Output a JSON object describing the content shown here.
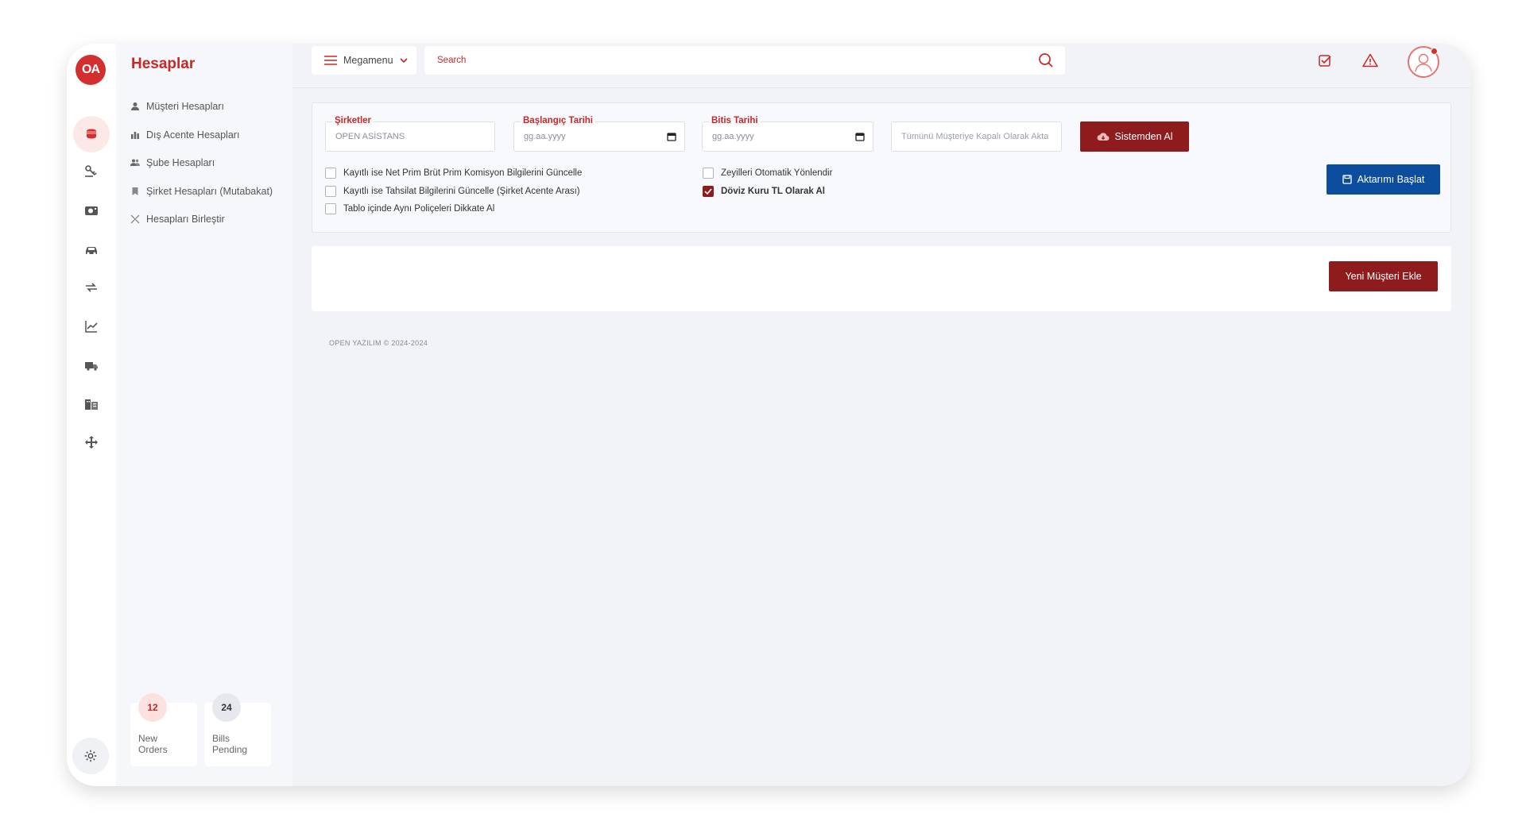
{
  "sidebar": {
    "logo_text": "OA",
    "rail_icons": [
      "coins-icon",
      "key-hand-icon",
      "camera-icon",
      "car-icon",
      "transfer-icon",
      "chart-icon",
      "truck-icon",
      "building-icon",
      "move-icon"
    ],
    "settings_icon": "gear-icon"
  },
  "submenu": {
    "title": "Hesaplar",
    "items": [
      {
        "label": "Müşteri Hesapları",
        "icon": "user-icon"
      },
      {
        "label": "Dış Acente Hesapları",
        "icon": "bar-chart-icon"
      },
      {
        "label": "Şube Hesapları",
        "icon": "users-icon"
      },
      {
        "label": "Şirket Hesapları (Mutabakat)",
        "icon": "bookmark-icon"
      },
      {
        "label": "Hesapları Birleştir",
        "icon": "merge-icon"
      }
    ],
    "stats": [
      {
        "count": "12",
        "label": "New Orders",
        "color": "#fde1e1"
      },
      {
        "count": "24",
        "label": "Bills Pending",
        "color": "#e6e8ee"
      }
    ]
  },
  "topbar": {
    "megamenu_label": "Megamenu",
    "search_placeholder": "Search"
  },
  "filters": {
    "company": {
      "label": "Şirketler",
      "value": "OPEN ASİSTANS"
    },
    "start_date": {
      "label": "Başlangıç Tarihi",
      "placeholder": "gg.aa.yyyy"
    },
    "end_date": {
      "label": "Bitis Tarihi",
      "placeholder": "gg.aa.yyyy"
    },
    "transfer_field": {
      "value": "Tümünü Müşteriye Kapalı Olarak Akta"
    },
    "fetch_button": "Sistemden Al",
    "start_button": "Aktarımı Başlat",
    "checkboxes": [
      {
        "label": "Kayıtlı ise Net Prim Brüt Prim Komisyon Bilgilerini Güncelle",
        "checked": false
      },
      {
        "label": "Kayıtlı ise Tahsilat Bilgilerini Güncelle (Şirket Acente Arası)",
        "checked": false
      },
      {
        "label": "Tablo içinde Aynı Poliçeleri Dikkate Al",
        "checked": false
      },
      {
        "label": "Zeyilleri Otomatik Yönlendir",
        "checked": false
      },
      {
        "label": "Döviz Kuru TL Olarak Al",
        "checked": true
      }
    ]
  },
  "actions": {
    "add_customer": "Yeni Müşteri Ekle"
  },
  "footer": {
    "text": "OPEN YAZILIM © 2024-2024"
  },
  "colors": {
    "accent_red": "#8e1c1c",
    "brand_red": "#d32f2f",
    "primary_blue": "#0d4d9e"
  }
}
